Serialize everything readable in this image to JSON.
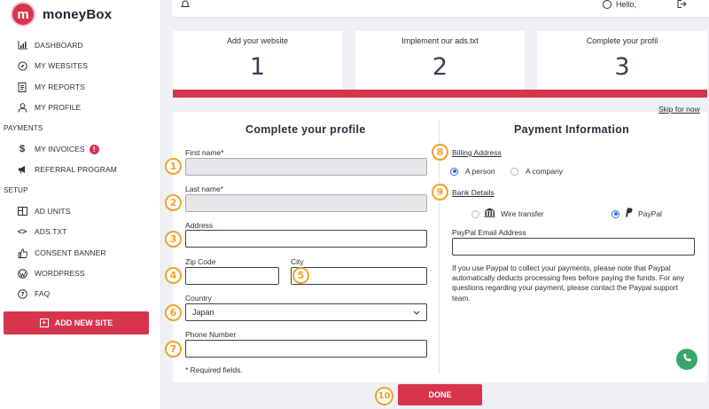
{
  "brand": {
    "mark": "m",
    "name_a": "money",
    "name_b": "Box"
  },
  "sidebar": {
    "items": [
      {
        "label": "DASHBOARD",
        "icon": "bar-chart-icon"
      },
      {
        "label": "MY WEBSITES",
        "icon": "compass-icon"
      },
      {
        "label": "MY REPORTS",
        "icon": "document-icon"
      },
      {
        "label": "MY PROFILE",
        "icon": "user-icon"
      }
    ],
    "payments_label": "PAYMENTS",
    "payments_items": [
      {
        "label": "MY INVOICES",
        "icon": "dollar-icon",
        "badge": "!"
      },
      {
        "label": "REFERRAL PROGRAM",
        "icon": "megaphone-icon"
      }
    ],
    "setup_label": "SETUP",
    "setup_items": [
      {
        "label": "AD UNITS",
        "icon": "layout-icon"
      },
      {
        "label": "ADS.TXT",
        "icon": "code-icon"
      },
      {
        "label": "CONSENT BANNER",
        "icon": "thumbs-up-icon"
      },
      {
        "label": "WORDPRESS",
        "icon": "wordpress-icon"
      },
      {
        "label": "FAQ",
        "icon": "question-icon"
      }
    ],
    "add_site": "ADD NEW SITE"
  },
  "topbar": {
    "greeting": "Hello,"
  },
  "steps": [
    {
      "title": "Add your website",
      "number": "1"
    },
    {
      "title": "Implement our ads.txt",
      "number": "2"
    },
    {
      "title": "Complete your profil",
      "number": "3"
    }
  ],
  "skip": "Skip for now",
  "profile": {
    "title": "Complete your profile",
    "first_name_label": "First name*",
    "last_name_label": "Last name*",
    "address_label": "Address",
    "zip_label": "Zip Code",
    "city_label": "City",
    "country_label": "Country",
    "country_value": "Japan",
    "phone_label": "Phone Number",
    "required_note": "* Required fields."
  },
  "payment": {
    "title": "Payment Information",
    "billing_label": "Billing Address",
    "billing_options": [
      "A person",
      "A company"
    ],
    "billing_selected": 0,
    "bank_label": "Bank Details",
    "bank_options": [
      "Wire transfer",
      "PayPal"
    ],
    "bank_selected": 1,
    "paypal_email_label": "PayPal Email Address",
    "note": "If you use Paypal to collect your payments, please note that Paypal automatically deducts processing fees before paying the funds. For any questions regarding your payment, please contact the Paypal support team."
  },
  "markers": [
    "1",
    "2",
    "3",
    "4",
    "5",
    "6",
    "7",
    "8",
    "9",
    "10"
  ],
  "done": "DONE",
  "colors": {
    "accent": "#d7344d",
    "marker": "#f2a024",
    "radio": "#3a6cd6",
    "chat": "#3aa56a"
  }
}
